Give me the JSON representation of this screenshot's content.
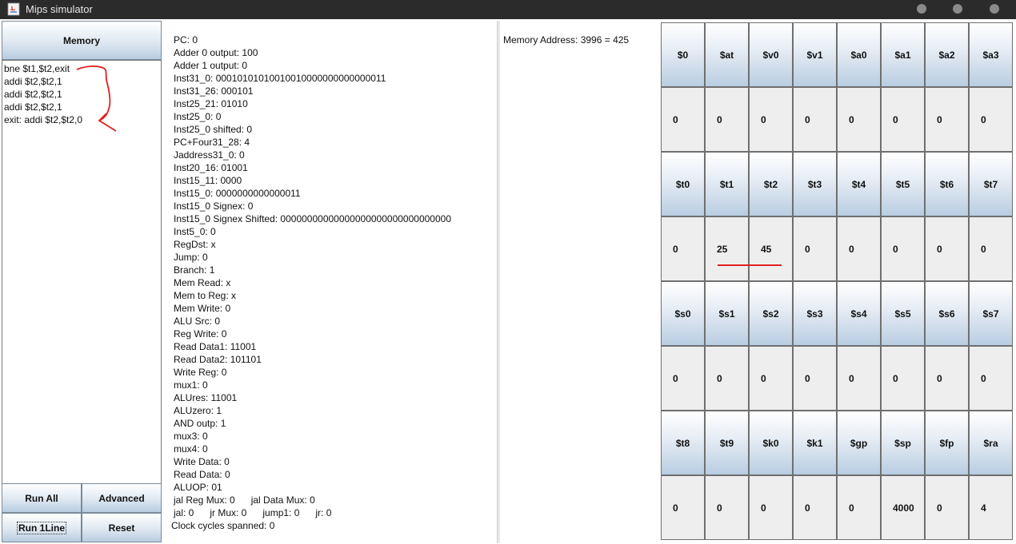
{
  "window": {
    "title": "Mips simulator"
  },
  "colors": {
    "titlebar": "#2b2b2b",
    "annotation": "#e02020",
    "button_gradient_end": "#b8cde0"
  },
  "left_panel": {
    "memory_button": "Memory",
    "code_lines": [
      "bne $t1,$t2,exit",
      "addi $t2,$t2,1",
      "addi $t2,$t2,1",
      "addi $t2,$t2,1",
      "exit: addi $t2,$t2,0"
    ],
    "buttons": {
      "run_all": "Run All",
      "advanced": "Advanced",
      "run_1line": "Run 1Line",
      "reset": "Reset"
    }
  },
  "info_lines": [
    "PC: 0",
    "Adder 0 output: 100",
    "Adder 1 output: 0",
    "Inst31_0: 00010101010010010000000000000011",
    "Inst31_26: 000101",
    "Inst25_21: 01010",
    "Inst25_0: 0",
    "Inst25_0 shifted: 0",
    "PC+Four31_28: 4",
    "Jaddress31_0: 0",
    "Inst20_16: 01001",
    "Inst15_11: 0000",
    "Inst15_0: 0000000000000011",
    "Inst15_0 Signex: 0",
    "Inst15_0 Signex Shifted: 00000000000000000000000000000000",
    "Inst5_0: 0",
    "RegDst: x",
    "Jump: 0",
    "Branch: 1",
    "Mem Read: x",
    "Mem to Reg: x",
    "Mem Write: 0",
    "ALU Src: 0",
    "Reg Write: 0",
    "Read Data1:  11001",
    "Read Data2:  101101",
    "Write Reg:  0",
    "mux1:  0",
    "ALUres:  11001",
    "ALUzero:  1",
    "AND outp:  1",
    "mux3:  0",
    "mux4:  0",
    "Write Data:  0",
    "Read Data: 0",
    "ALUOP: 01",
    "jal Reg Mux: 0      jal Data Mux: 0",
    "jal: 0      jr Mux: 0      jump1: 0      jr: 0",
    "Clock cycles spanned: 0"
  ],
  "memory_address": "Memory Address: 3996 = 425",
  "registers": [
    {
      "names": [
        "$0",
        "$at",
        "$v0",
        "$v1",
        "$a0",
        "$a1",
        "$a2",
        "$a3"
      ],
      "values": [
        "0",
        "0",
        "0",
        "0",
        "0",
        "0",
        "0",
        "0"
      ]
    },
    {
      "names": [
        "$t0",
        "$t1",
        "$t2",
        "$t3",
        "$t4",
        "$t5",
        "$t6",
        "$t7"
      ],
      "values": [
        "0",
        "25",
        "45",
        "0",
        "0",
        "0",
        "0",
        "0"
      ]
    },
    {
      "names": [
        "$s0",
        "$s1",
        "$s2",
        "$s3",
        "$s4",
        "$s5",
        "$s6",
        "$s7"
      ],
      "values": [
        "0",
        "0",
        "0",
        "0",
        "0",
        "0",
        "0",
        "0"
      ]
    },
    {
      "names": [
        "$t8",
        "$t9",
        "$k0",
        "$k1",
        "$gp",
        "$sp",
        "$fp",
        "$ra"
      ],
      "values": [
        "0",
        "0",
        "0",
        "0",
        "0",
        "4000",
        "0",
        "4"
      ]
    }
  ]
}
